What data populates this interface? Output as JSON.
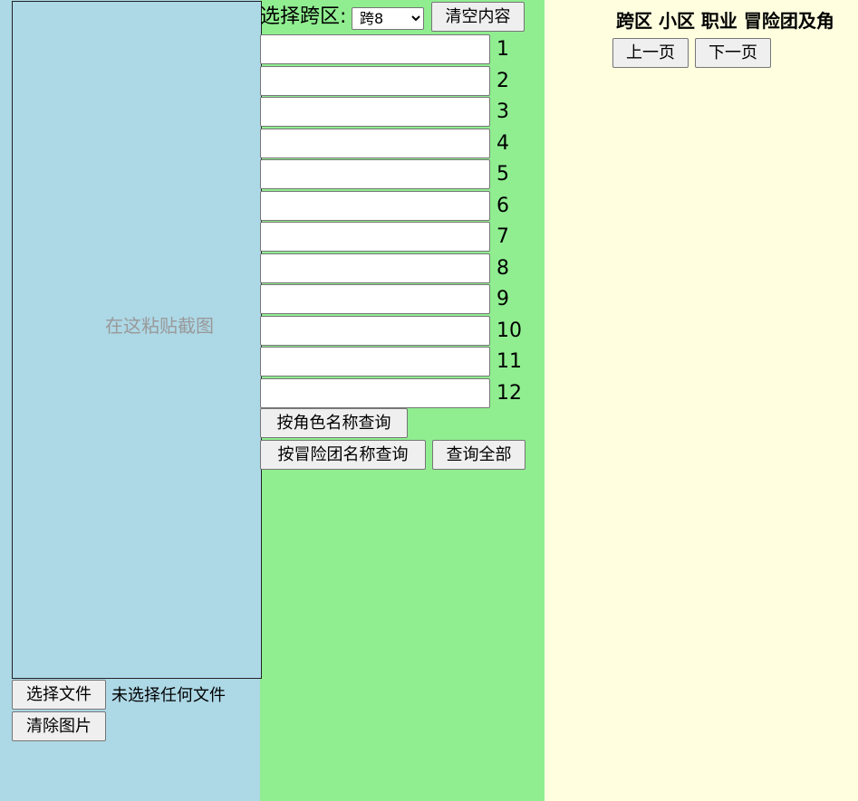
{
  "left_panel": {
    "paste_placeholder": "在这粘贴截图",
    "choose_file_button": "选择文件",
    "file_status": "未选择任何文件",
    "clear_image_button": "清除图片"
  },
  "middle_panel": {
    "region_label": "选择跨区:",
    "region_selected": "跨8",
    "clear_content_button": "清空内容",
    "name_inputs": [
      {
        "number": "1",
        "value": ""
      },
      {
        "number": "2",
        "value": ""
      },
      {
        "number": "3",
        "value": ""
      },
      {
        "number": "4",
        "value": ""
      },
      {
        "number": "5",
        "value": ""
      },
      {
        "number": "6",
        "value": ""
      },
      {
        "number": "7",
        "value": ""
      },
      {
        "number": "8",
        "value": ""
      },
      {
        "number": "9",
        "value": ""
      },
      {
        "number": "10",
        "value": ""
      },
      {
        "number": "11",
        "value": ""
      },
      {
        "number": "12",
        "value": ""
      }
    ],
    "query_by_role_button": "按角色名称查询",
    "query_by_guild_button": "按冒险团名称查询",
    "query_all_button": "查询全部"
  },
  "right_panel": {
    "header_title": "跨区 小区 职业 冒险团及角",
    "prev_page_button": "上一页",
    "next_page_button": "下一页"
  },
  "colors": {
    "left_bg": "#add8e6",
    "middle_bg": "#90ee90",
    "right_bg": "#ffffe0"
  }
}
